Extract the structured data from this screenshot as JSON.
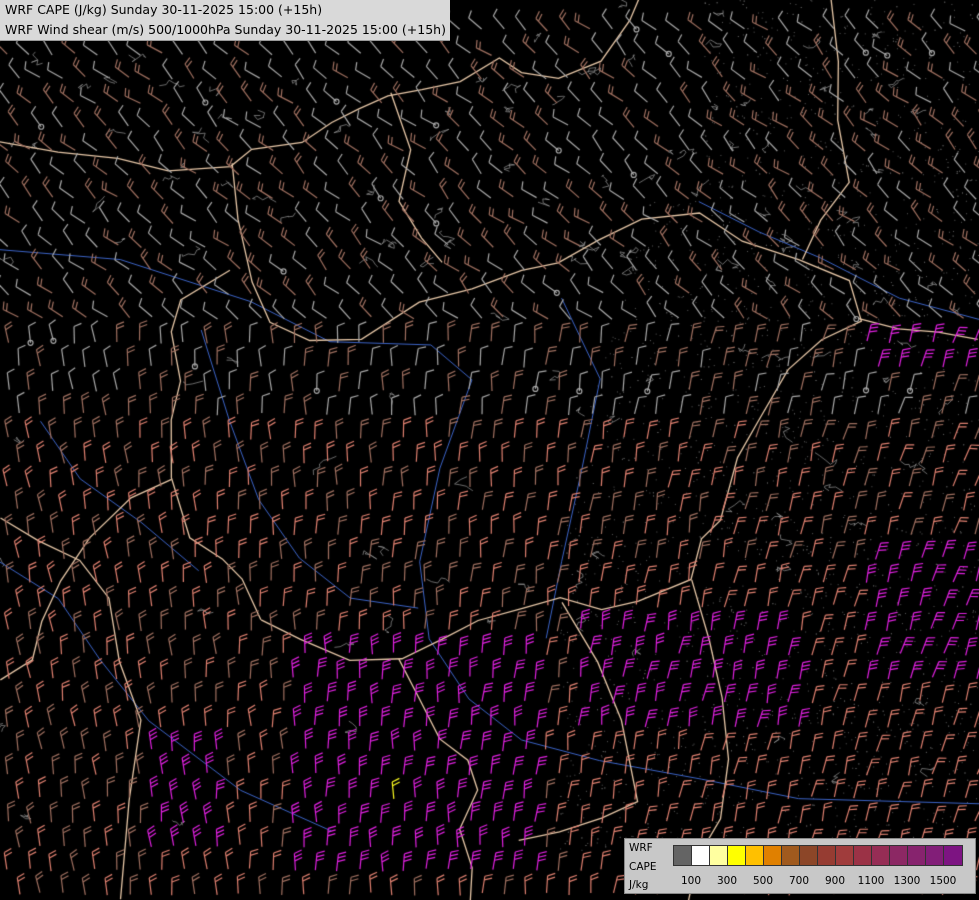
{
  "header": {
    "line1": "WRF CAPE (J/kg) Sunday 30-11-2025 15:00 (+15h)",
    "line2": "WRF Wind shear (m/s) 500/1000hPa Sunday 30-11-2025 15:00 (+15h)"
  },
  "legend": {
    "label_line1": "WRF",
    "label_line2": "CAPE",
    "label_line3": "J/kg",
    "swatch_colors": [
      "#646464",
      "#ffffff",
      "#ffffa0",
      "#ffff00",
      "#ffc000",
      "#e08000",
      "#a05a1e",
      "#8c4628",
      "#963c32",
      "#a03c3c",
      "#9b3246",
      "#962d55",
      "#8c2864",
      "#87236e",
      "#821e78",
      "#7d1482"
    ],
    "ticks": [
      {
        "value": "100",
        "slot": 1
      },
      {
        "value": "300",
        "slot": 3
      },
      {
        "value": "500",
        "slot": 5
      },
      {
        "value": "700",
        "slot": 7
      },
      {
        "value": "900",
        "slot": 9
      },
      {
        "value": "1100",
        "slot": 11
      },
      {
        "value": "1300",
        "slot": 13
      },
      {
        "value": "1500",
        "slot": 15
      }
    ]
  },
  "colors": {
    "background": "#000000",
    "borders": "#e8c8a8",
    "rivers": "#3c64c8",
    "contours": "#9a9a9a",
    "barb_grey": "#a8a8a8",
    "barb_brown": "#a07060",
    "barb_salmon": "#e08070",
    "barb_magenta": "#e020e0",
    "barb_yellow": "#ffff20"
  }
}
